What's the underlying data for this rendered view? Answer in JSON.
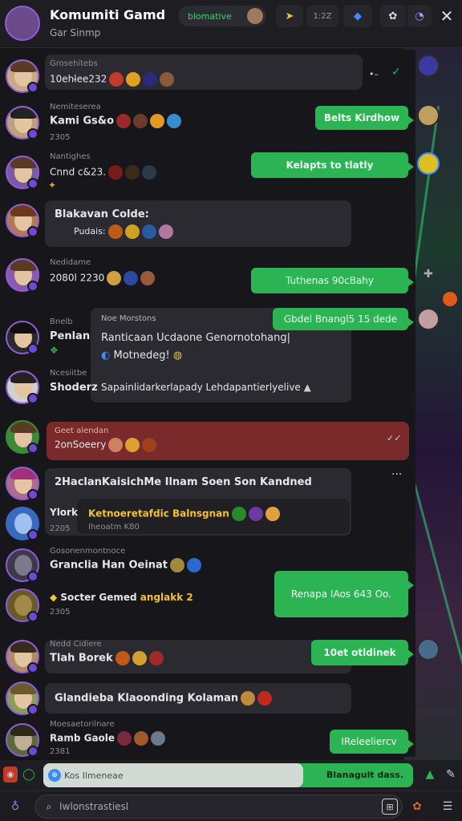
{
  "header": {
    "title": "Komumiti Gamd",
    "subtitle": "Gar Sinmp",
    "pill_label": "blomative",
    "count_label": "1:2Z"
  },
  "messages": [
    {
      "username": "Grosehitebs",
      "text": "10ehl̵ee232",
      "bubble": ""
    },
    {
      "username": "Nemiteserea",
      "text": "Kami Gs&o",
      "time": "2305",
      "bubble": "Belts Kirdhow"
    },
    {
      "username": "Nantighes",
      "text": "Cnnd c&23.",
      "bubble": "Kelapts to tlatly"
    },
    {
      "username": "",
      "text": "Blakavan Colde:",
      "sub": "Pudais:",
      "bubble": ""
    },
    {
      "username": "Nedidame",
      "text": "2080l 2230",
      "bubble": "Tuthenas 90cBahy"
    },
    {
      "username": "Bnelb",
      "text": "Penlan",
      "bubble": "Gbdel Bnangl5 15 dede"
    },
    {
      "username": "Ncesiitbe",
      "text": "Shoderz",
      "bubble": ""
    },
    {
      "username": "Geet alendan",
      "text": "2onSoeery",
      "bubble": ""
    },
    {
      "username": "",
      "text": "2HaclanKaisichMe Ilnam Soen Son Kandned",
      "bubble": ""
    },
    {
      "username": "Ylork",
      "text": "2205",
      "bubble": ""
    },
    {
      "username": "Gosonenmontnoce",
      "text": "Granclia Han Oeinat",
      "bubble": ""
    },
    {
      "username": "",
      "text": "Socter Gemed",
      "time": "2305",
      "bubble": "Renapa IAos 643 Oo."
    },
    {
      "username": "Nedd Cidiere",
      "text": "Tlah Borek",
      "bubble": "10et otldinek"
    },
    {
      "username": "",
      "text": "Glandieba Klaoonding Kolaman",
      "bubble": ""
    },
    {
      "username": "Moesaetorilnare",
      "text": "Ramb Gaole",
      "time": "2381",
      "bubble": "IReleeliercv"
    }
  ],
  "cards": {
    "quote_title": "Noe Morstons",
    "quote_line1": "Ranticaan Ucdaone Genornotohang|",
    "quote_line2": "Motnedeg!",
    "quote_line3": "Sapainlidarkerlapady Lehdapantierlyelive",
    "nested_text": "Ketnoeretafdic Balnsgnan",
    "nested_sub": "Iheoatm K80",
    "highlight": "anglakk 2"
  },
  "compose": {
    "placeholder": "Kos Ilmeneae",
    "send_label": "Blanagult dass."
  },
  "search": {
    "placeholder": "Iwlonstrastiesl"
  },
  "colors": {
    "accent_green": "#2cb454",
    "accent_purple": "#8e5cd6",
    "alert_red": "#7a2a2a"
  }
}
